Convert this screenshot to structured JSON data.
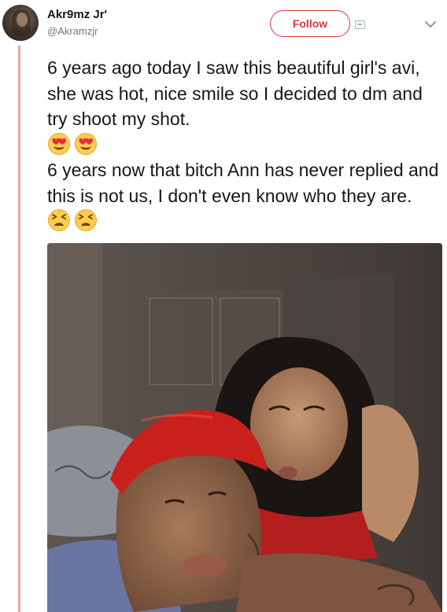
{
  "user": {
    "display_name": "Akr9mz Jr'",
    "handle": "@Akramzjr"
  },
  "actions": {
    "follow_label": "Follow"
  },
  "icons": {
    "menu": "chevron-down-icon",
    "badge": "follow-badge-icon",
    "emoji_1": "heart-eyes-emoji-icon",
    "emoji_2": "tired-face-emoji-icon"
  },
  "tweet": {
    "paragraph_1": "6 years ago today I saw this beautiful girl's avi, she was hot, nice smile so I decided to dm and try shoot my shot.",
    "paragraph_2": "6 years now that bitch Ann has never replied and this is not us, I don't even know who they are."
  },
  "colors": {
    "accent": "#d33a3a",
    "thread_line": "#e8a6a3",
    "handle_gray": "#657786",
    "text": "#14171a"
  }
}
